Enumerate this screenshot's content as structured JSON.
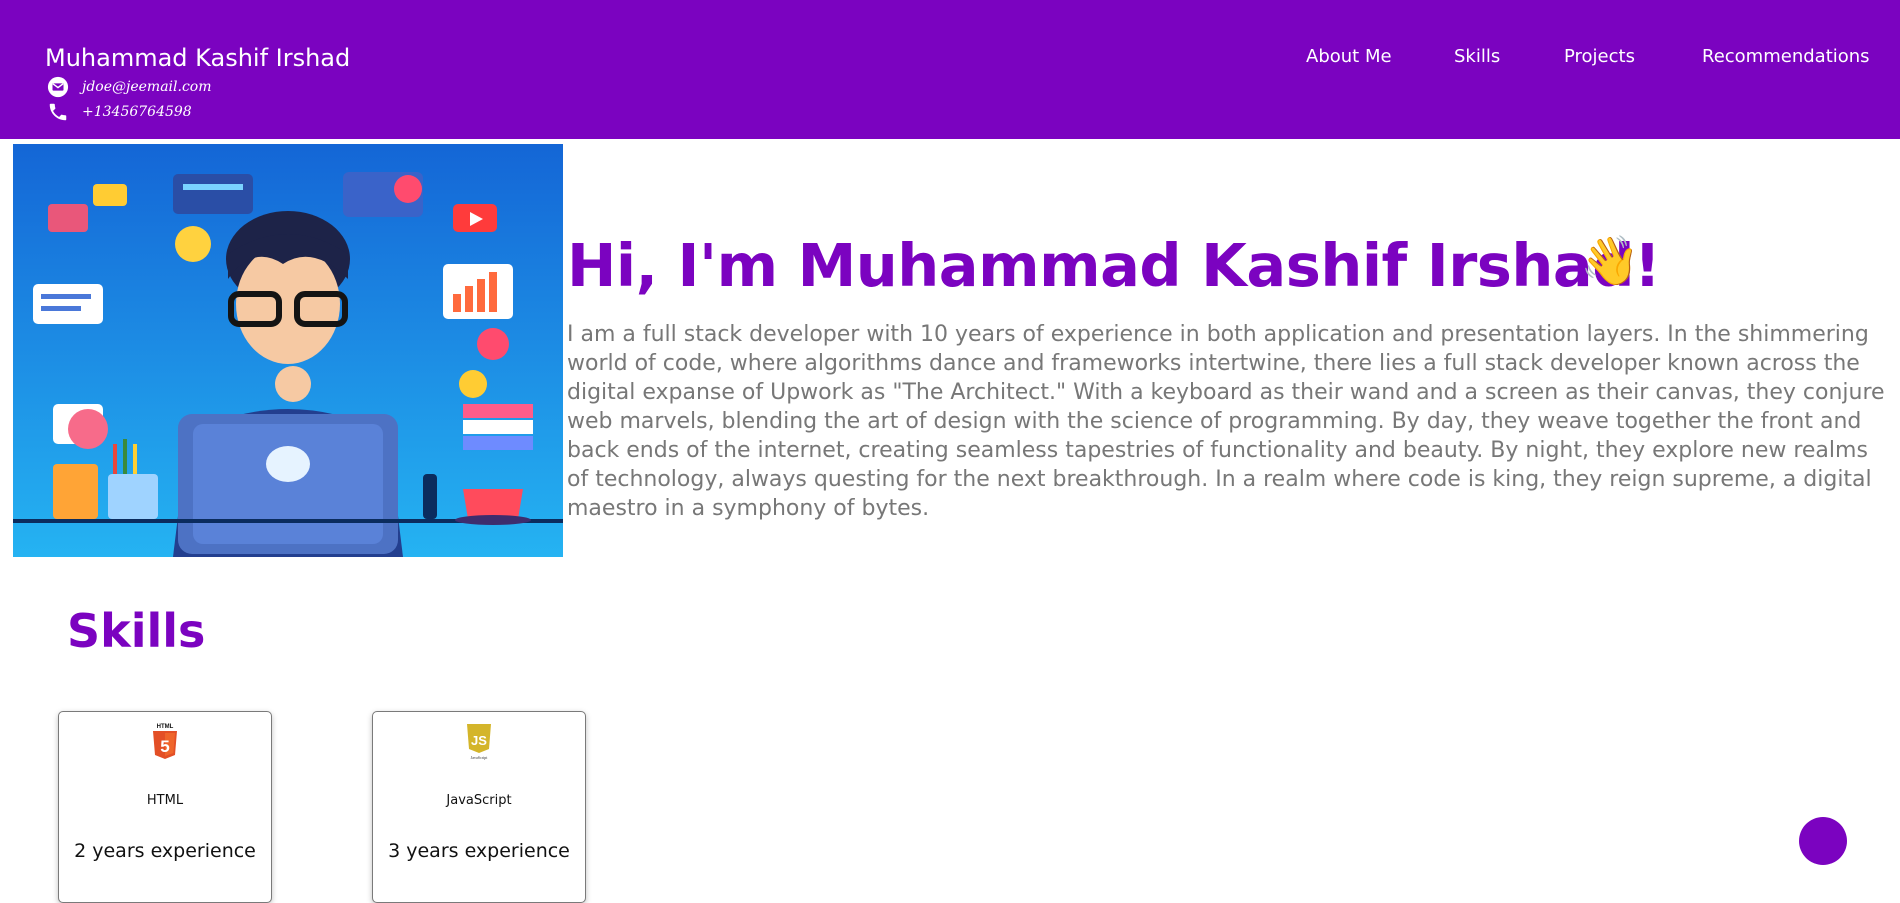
{
  "header": {
    "name": "Muhammad Kashif Irshad",
    "email": "jdoe@jeemail.com",
    "phone": "+13456764598",
    "nav": [
      "About Me",
      "Skills",
      "Projects",
      "Recommendations"
    ]
  },
  "hero": {
    "title": "Hi, I'm Muhammad Kashif Irshad!",
    "wave_emoji": "👋",
    "bio": "I am a full stack developer with 10 years of experience in both application and presentation layers. In the shimmering world of code, where algorithms dance and frameworks intertwine, there lies a full stack developer known across the digital expanse of Upwork as \"The Architect.\" With a keyboard as their wand and a screen as their canvas, they conjure web marvels, blending the art of design with the science of programming. By day, they weave together the front and back ends of the internet, creating seamless tapestries of functionality and beauty. By night, they explore new realms of technology, always questing for the next breakthrough. In a realm where code is king, they reign supreme, a digital maestro in a symphony of bytes."
  },
  "skills": {
    "title": "Skills",
    "items": [
      {
        "name": "HTML",
        "experience": "2 years experience",
        "icon": "html5-icon",
        "icon_label": "HTML",
        "icon_glyph": "5"
      },
      {
        "name": "JavaScript",
        "experience": "3 years experience",
        "icon": "javascript-icon",
        "icon_glyph": "JS",
        "icon_caption": "JavaScript"
      }
    ]
  },
  "colors": {
    "brand": "#7b03c0",
    "bio_text": "#777777",
    "header_text": "#ffffff"
  }
}
